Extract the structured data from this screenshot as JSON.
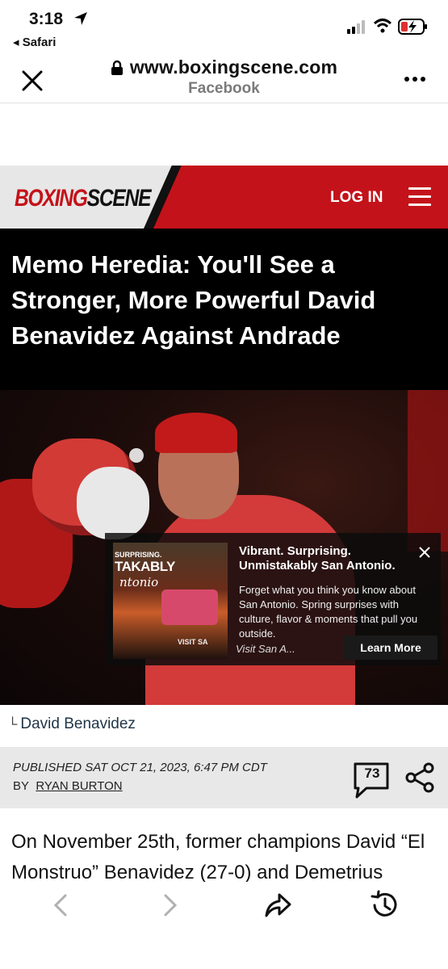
{
  "status": {
    "time": "3:18",
    "back_app": "◂ Safari"
  },
  "browser": {
    "url": "www.boxingscene.com",
    "source": "Facebook"
  },
  "site": {
    "logo_part1": "BOXING",
    "logo_part2": "SCENE",
    "login": "LOG IN"
  },
  "article": {
    "headline": "Memo Heredia: You'll See a Stronger, More Powerful David Benavidez Against Andrade",
    "caption": "David Benavidez",
    "published": "PUBLISHED  SAT OCT 21, 2023, 6:47 PM CDT",
    "by": "BY",
    "author": "RYAN BURTON",
    "comment_count": "73",
    "body": "On November 25th, former champions David “El Monstruo” Benavidez (27-0) and Demetrius"
  },
  "ad": {
    "image_text_1": "SURPRISING.",
    "image_text_2": "TAKABLY",
    "image_text_3": "ntonio",
    "image_text_4": "VISIT SA",
    "title": "Vibrant. Surprising. Unmistakably San Antonio.",
    "body": "Forget what you think you know about San Antonio. Spring surprises with culture, flavor & moments that pull you outside.",
    "source": "Visit San A...",
    "cta": "Learn More"
  },
  "colors": {
    "brand_red": "#c4121a",
    "header_bg": "#e7e7e7",
    "meta_bg": "#e8e8e8"
  },
  "icons": [
    "location-arrow-icon",
    "signal-icon",
    "wifi-icon",
    "battery-icon",
    "close-icon",
    "lock-icon",
    "more-icon",
    "menu-icon",
    "comment-icon",
    "share-icon",
    "back-icon",
    "forward-icon",
    "share-arrow-icon",
    "history-icon"
  ]
}
